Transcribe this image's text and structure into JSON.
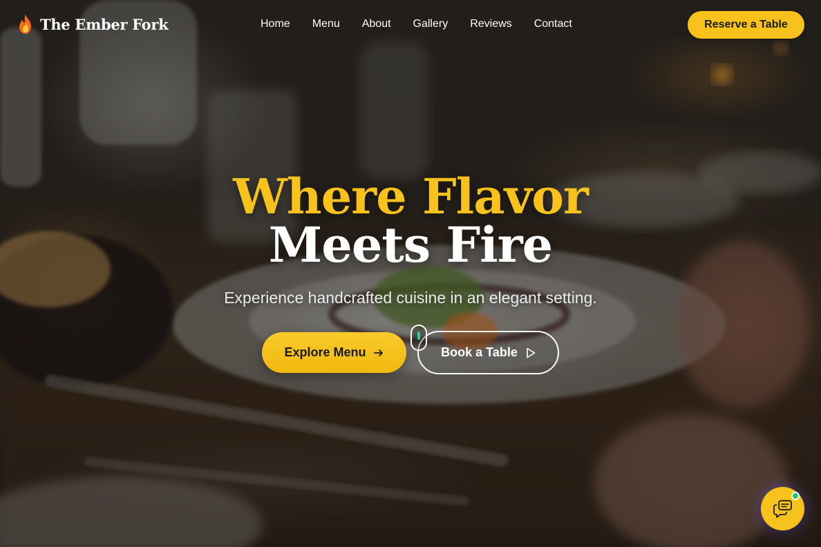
{
  "brand": {
    "name": "The Ember Fork",
    "icon": "flame-icon"
  },
  "nav": {
    "links": [
      {
        "label": "Home"
      },
      {
        "label": "Menu"
      },
      {
        "label": "About"
      },
      {
        "label": "Gallery"
      },
      {
        "label": "Reviews"
      },
      {
        "label": "Contact"
      }
    ],
    "cta_label": "Reserve a Table"
  },
  "hero": {
    "headline_line1": "Where Flavor",
    "headline_line2": "Meets Fire",
    "subtitle": "Experience handcrafted cuisine in an elegant setting.",
    "primary_button_label": "Explore Menu",
    "primary_button_icon": "arrow-right-icon",
    "secondary_button_label": "Book a Table",
    "secondary_button_icon": "play-icon"
  },
  "chat_widget": {
    "icon": "chat-icon",
    "status": "online"
  },
  "colors": {
    "accent": "#f6c21b",
    "text": "#ffffff",
    "online": "#22c55e"
  }
}
